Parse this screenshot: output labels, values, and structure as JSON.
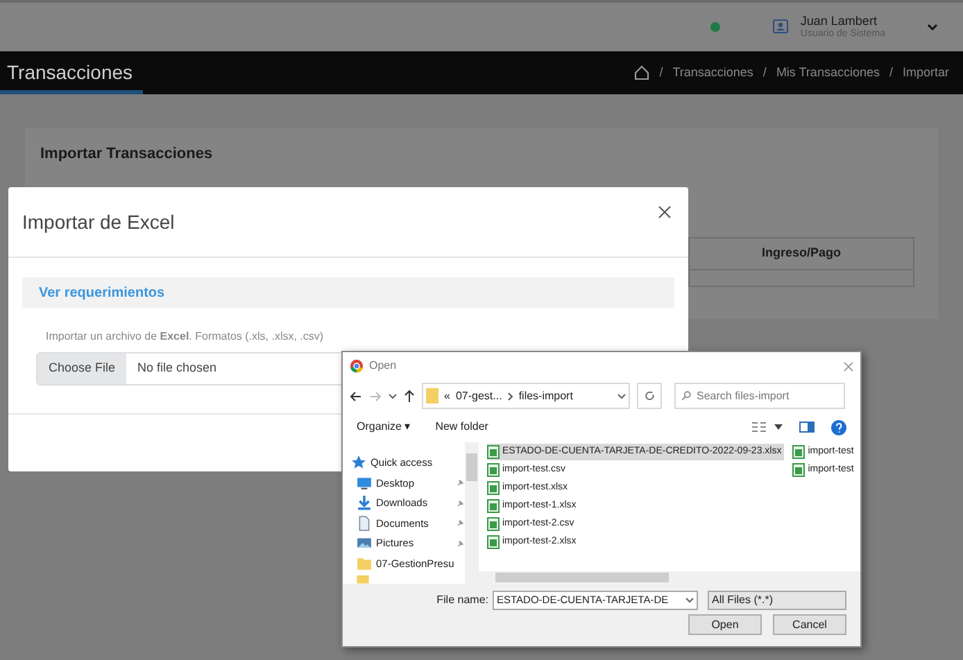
{
  "topbar": {
    "user_name": "Juan Lambert",
    "user_role": "Usuario de Sistema"
  },
  "navbar": {
    "title": "Transacciones",
    "breadcrumb_separator": "/",
    "breadcrumb": [
      "Transacciones",
      "Mis Transacciones",
      "Importar"
    ]
  },
  "card": {
    "title": "Importar Transacciones",
    "table_columns": [
      "Ingreso/Pago"
    ]
  },
  "modal": {
    "title": "Importar de Excel",
    "requirements_link": "Ver requerimientos",
    "instruction": "Importar un archivo de **Excel**. Formatos (.xls, .xlsx, .csv)",
    "choose_button": "Choose File",
    "file_status": "No file chosen"
  },
  "file_dialog": {
    "title": "Open",
    "path": [
      "07-gest...",
      "files-import"
    ],
    "path_prefix": "«",
    "search": {
      "placeholder": "Search files-import"
    },
    "toolbar": [
      "Organize ▾",
      "New folder"
    ],
    "sidebar": [
      {
        "label": "Quick access",
        "kind": "star",
        "pinned": false
      },
      {
        "label": "Desktop",
        "kind": "desktop",
        "pinned": true
      },
      {
        "label": "Downloads",
        "kind": "download",
        "pinned": true
      },
      {
        "label": "Documents",
        "kind": "document",
        "pinned": true
      },
      {
        "label": "Pictures",
        "kind": "picture",
        "pinned": true
      },
      {
        "label": "07-GestionPresu",
        "kind": "folder",
        "pinned": false
      }
    ],
    "files": [
      {
        "name": "ESTADO-DE-CUENTA-TARJETA-DE-CREDITO-2022-09-23.xlsx",
        "selected": true
      },
      {
        "name": "import-test.csv",
        "selected": false
      },
      {
        "name": "import-test.xlsx",
        "selected": false
      },
      {
        "name": "import-test-1.xlsx",
        "selected": false
      },
      {
        "name": "import-test-2.csv",
        "selected": false
      },
      {
        "name": "import-test-2.xlsx",
        "selected": false
      }
    ],
    "files_column_2": [
      {
        "name": "import-test",
        "selected": false
      },
      {
        "name": "import-test",
        "selected": false
      }
    ],
    "file_name_label": "File name:",
    "file_name": "ESTADO-DE-CUENTA-TARJETA-DE",
    "filter": "All Files (*.*)",
    "buttons": [
      "Open",
      "Cancel"
    ]
  }
}
